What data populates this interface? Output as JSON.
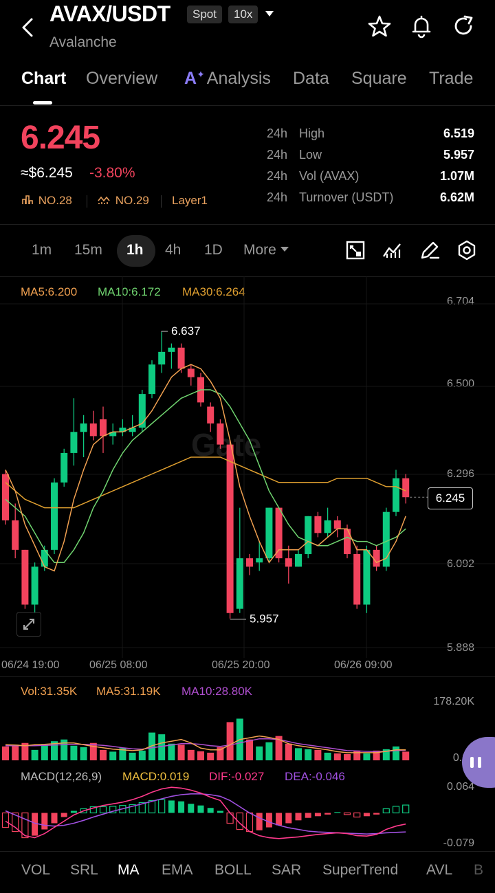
{
  "header": {
    "pair": "AVAX/USDT",
    "spot_tag": "Spot",
    "leverage_tag": "10x",
    "coin_name": "Avalanche"
  },
  "tabs": [
    {
      "label": "Chart"
    },
    {
      "label": "Overview"
    },
    {
      "label": "Analysis",
      "prefix": "A"
    },
    {
      "label": "Data"
    },
    {
      "label": "Square"
    },
    {
      "label": "Trade"
    }
  ],
  "price": {
    "last": "6.245",
    "usd": "≈$6.245",
    "change": "-3.80%",
    "rank1": "NO.28",
    "rank2": "NO.29",
    "category": "Layer1"
  },
  "stats": [
    {
      "period": "24h",
      "label": "High",
      "value": "6.519"
    },
    {
      "period": "24h",
      "label": "Low",
      "value": "5.957"
    },
    {
      "period": "24h",
      "label": "Vol (AVAX)",
      "value": "1.07M"
    },
    {
      "period": "24h",
      "label": "Turnover (USDT)",
      "value": "6.62M"
    }
  ],
  "intervals": [
    {
      "label": "1m"
    },
    {
      "label": "15m"
    },
    {
      "label": "1h"
    },
    {
      "label": "4h"
    },
    {
      "label": "1D"
    },
    {
      "label": "More"
    }
  ],
  "colors": {
    "up": "#0ecb81",
    "down": "#f2435d",
    "ma5": "#f0a050",
    "ma10": "#6fd36f",
    "ma30": "#e0a030",
    "macd_dif": "#ff3a8c",
    "macd_dea": "#a050e0"
  },
  "chart_legend": {
    "ma5": "MA5:6.200",
    "ma10": "MA10:6.172",
    "ma30": "MA30:6.264"
  },
  "watermark": "Gate",
  "price_axis": [
    "6.704",
    "6.500",
    "6.296",
    "6.092",
    "5.888"
  ],
  "time_axis": [
    "06/24 19:00",
    "06/25 08:00",
    "06/25 20:00",
    "06/26 09:00"
  ],
  "annotations": {
    "high": "6.637",
    "low": "5.957"
  },
  "current_price_box": "6.245",
  "volume": {
    "vol": "Vol:31.35K",
    "ma5": "MA5:31.19K",
    "ma10": "MA10:28.80K",
    "axis_top": "178.20K",
    "axis_bottom": "0.00"
  },
  "macd": {
    "params": "MACD(12,26,9)",
    "macd": "MACD:0.019",
    "dif": "DIF:-0.027",
    "dea": "DEA:-0.046",
    "axis_top": "0.064",
    "axis_bottom": "-0.079"
  },
  "indicator_tabs": [
    {
      "label": "VOL"
    },
    {
      "label": "SRL"
    },
    {
      "label": "MA"
    },
    {
      "label": "EMA"
    },
    {
      "label": "BOLL"
    },
    {
      "label": "SAR"
    },
    {
      "label": "SuperTrend"
    },
    {
      "label": "AVL"
    },
    {
      "label": "B"
    }
  ],
  "candles": [
    {
      "o": 6.3,
      "h": 6.31,
      "l": 6.18,
      "c": 6.19
    },
    {
      "o": 6.19,
      "h": 6.23,
      "l": 6.1,
      "c": 6.12
    },
    {
      "o": 6.12,
      "h": 6.12,
      "l": 5.98,
      "c": 5.99
    },
    {
      "o": 5.99,
      "h": 6.09,
      "l": 5.97,
      "c": 6.08
    },
    {
      "o": 6.08,
      "h": 6.13,
      "l": 6.07,
      "c": 6.12
    },
    {
      "o": 6.12,
      "h": 6.29,
      "l": 6.11,
      "c": 6.28
    },
    {
      "o": 6.28,
      "h": 6.36,
      "l": 6.27,
      "c": 6.35
    },
    {
      "o": 6.35,
      "h": 6.48,
      "l": 6.32,
      "c": 6.4
    },
    {
      "o": 6.4,
      "h": 6.44,
      "l": 6.34,
      "c": 6.42
    },
    {
      "o": 6.42,
      "h": 6.45,
      "l": 6.38,
      "c": 6.39
    },
    {
      "o": 6.43,
      "h": 6.46,
      "l": 6.35,
      "c": 6.39
    },
    {
      "o": 6.39,
      "h": 6.42,
      "l": 6.37,
      "c": 6.4
    },
    {
      "o": 6.4,
      "h": 6.43,
      "l": 6.39,
      "c": 6.41
    },
    {
      "o": 6.4,
      "h": 6.44,
      "l": 6.39,
      "c": 6.41
    },
    {
      "o": 6.41,
      "h": 6.5,
      "l": 6.4,
      "c": 6.49
    },
    {
      "o": 6.49,
      "h": 6.57,
      "l": 6.48,
      "c": 6.56
    },
    {
      "o": 6.56,
      "h": 6.637,
      "l": 6.54,
      "c": 6.59
    },
    {
      "o": 6.59,
      "h": 6.61,
      "l": 6.55,
      "c": 6.6
    },
    {
      "o": 6.6,
      "h": 6.61,
      "l": 6.54,
      "c": 6.55
    },
    {
      "o": 6.55,
      "h": 6.56,
      "l": 6.51,
      "c": 6.53
    },
    {
      "o": 6.53,
      "h": 6.54,
      "l": 6.46,
      "c": 6.47
    },
    {
      "o": 6.46,
      "h": 6.47,
      "l": 6.4,
      "c": 6.42
    },
    {
      "o": 6.42,
      "h": 6.43,
      "l": 6.36,
      "c": 6.37
    },
    {
      "o": 6.37,
      "h": 6.38,
      "l": 5.957,
      "c": 5.97
    },
    {
      "o": 5.98,
      "h": 6.22,
      "l": 5.97,
      "c": 6.1
    },
    {
      "o": 6.1,
      "h": 6.11,
      "l": 6.06,
      "c": 6.08
    },
    {
      "o": 6.09,
      "h": 6.14,
      "l": 6.07,
      "c": 6.1
    },
    {
      "o": 6.1,
      "h": 6.22,
      "l": 6.09,
      "c": 6.22
    },
    {
      "o": 6.22,
      "h": 6.22,
      "l": 6.09,
      "c": 6.1
    },
    {
      "o": 6.1,
      "h": 6.13,
      "l": 6.04,
      "c": 6.08
    },
    {
      "o": 6.08,
      "h": 6.12,
      "l": 6.08,
      "c": 6.11
    },
    {
      "o": 6.11,
      "h": 6.2,
      "l": 6.1,
      "c": 6.2
    },
    {
      "o": 6.2,
      "h": 6.21,
      "l": 6.15,
      "c": 6.16
    },
    {
      "o": 6.16,
      "h": 6.22,
      "l": 6.15,
      "c": 6.19
    },
    {
      "o": 6.19,
      "h": 6.2,
      "l": 6.15,
      "c": 6.17
    },
    {
      "o": 6.17,
      "h": 6.18,
      "l": 6.1,
      "c": 6.11
    },
    {
      "o": 6.11,
      "h": 6.13,
      "l": 5.98,
      "c": 5.99
    },
    {
      "o": 5.99,
      "h": 6.13,
      "l": 5.97,
      "c": 6.12
    },
    {
      "o": 6.12,
      "h": 6.13,
      "l": 6.07,
      "c": 6.08
    },
    {
      "o": 6.08,
      "h": 6.22,
      "l": 6.07,
      "c": 6.21
    },
    {
      "o": 6.21,
      "h": 6.31,
      "l": 6.2,
      "c": 6.29
    },
    {
      "o": 6.29,
      "h": 6.3,
      "l": 6.23,
      "c": 6.245
    }
  ],
  "ma5": [
    6.31,
    6.26,
    6.18,
    6.13,
    6.08,
    6.07,
    6.14,
    6.24,
    6.31,
    6.37,
    6.39,
    6.4,
    6.4,
    6.41,
    6.42,
    6.45,
    6.49,
    6.53,
    6.55,
    6.56,
    6.55,
    6.52,
    6.48,
    6.38,
    6.27,
    6.2,
    6.14,
    6.09,
    6.12,
    6.12,
    6.12,
    6.14,
    6.13,
    6.15,
    6.17,
    6.17,
    6.12,
    6.12,
    6.09,
    6.1,
    6.14,
    6.2
  ],
  "ma10": [
    6.24,
    6.22,
    6.2,
    6.16,
    6.12,
    6.09,
    6.09,
    6.12,
    6.16,
    6.22,
    6.26,
    6.31,
    6.35,
    6.38,
    6.4,
    6.42,
    6.44,
    6.46,
    6.48,
    6.49,
    6.5,
    6.5,
    6.49,
    6.46,
    6.42,
    6.38,
    6.32,
    6.26,
    6.22,
    6.18,
    6.15,
    6.14,
    6.13,
    6.13,
    6.14,
    6.15,
    6.14,
    6.14,
    6.13,
    6.14,
    6.15,
    6.17
  ],
  "ma30": [
    6.28,
    6.26,
    6.24,
    6.23,
    6.22,
    6.22,
    6.22,
    6.22,
    6.23,
    6.24,
    6.25,
    6.26,
    6.27,
    6.28,
    6.29,
    6.3,
    6.31,
    6.32,
    6.33,
    6.34,
    6.34,
    6.34,
    6.34,
    6.33,
    6.32,
    6.31,
    6.3,
    6.29,
    6.28,
    6.28,
    6.28,
    6.28,
    6.28,
    6.28,
    6.29,
    6.29,
    6.29,
    6.29,
    6.28,
    6.27,
    6.27,
    6.26
  ],
  "vol_values": [
    40,
    45,
    50,
    30,
    45,
    55,
    60,
    42,
    38,
    50,
    30,
    25,
    35,
    22,
    28,
    80,
    75,
    48,
    45,
    30,
    26,
    22,
    38,
    110,
    120,
    60,
    40,
    52,
    70,
    48,
    35,
    32,
    30,
    22,
    20,
    18,
    28,
    20,
    28,
    32,
    40,
    25
  ],
  "vol_ma5": [
    45,
    44,
    42,
    45,
    46,
    48,
    50,
    50,
    45,
    40,
    36,
    32,
    30,
    28,
    30,
    42,
    50,
    55,
    60,
    50,
    35,
    30,
    30,
    45,
    60,
    65,
    70,
    66,
    60,
    48,
    42,
    38,
    34,
    30,
    25,
    22,
    22,
    22,
    22,
    26,
    30,
    30
  ],
  "vol_ma10": [
    42,
    42,
    42,
    42,
    43,
    44,
    45,
    46,
    46,
    45,
    43,
    40,
    36,
    33,
    32,
    36,
    40,
    44,
    48,
    48,
    46,
    42,
    40,
    44,
    50,
    56,
    62,
    62,
    60,
    54,
    48,
    44,
    40,
    36,
    32,
    28,
    27,
    26,
    25,
    26,
    28,
    29
  ],
  "macd_hist": [
    -0.035,
    -0.045,
    -0.06,
    -0.055,
    -0.04,
    -0.025,
    -0.01,
    0.005,
    0.01,
    0.015,
    0.015,
    0.016,
    0.018,
    0.02,
    0.025,
    0.03,
    0.032,
    0.03,
    0.028,
    0.022,
    0.018,
    0.012,
    0.005,
    -0.025,
    -0.04,
    -0.045,
    -0.042,
    -0.035,
    -0.03,
    -0.025,
    -0.018,
    -0.012,
    -0.008,
    -0.004,
    0.002,
    -0.004,
    -0.01,
    -0.008,
    -0.004,
    0.01,
    0.016,
    0.019
  ],
  "macd_dif": [
    -0.02,
    -0.035,
    -0.055,
    -0.06,
    -0.05,
    -0.035,
    -0.02,
    -0.005,
    0.005,
    0.012,
    0.018,
    0.022,
    0.026,
    0.032,
    0.04,
    0.05,
    0.058,
    0.062,
    0.06,
    0.055,
    0.048,
    0.038,
    0.03,
    0.0,
    -0.025,
    -0.045,
    -0.055,
    -0.06,
    -0.062,
    -0.06,
    -0.058,
    -0.055,
    -0.052,
    -0.05,
    -0.048,
    -0.05,
    -0.055,
    -0.056,
    -0.052,
    -0.04,
    -0.032,
    -0.027
  ],
  "macd_dea": [
    0.005,
    -0.005,
    -0.015,
    -0.025,
    -0.03,
    -0.032,
    -0.03,
    -0.025,
    -0.018,
    -0.01,
    -0.003,
    0.004,
    0.01,
    0.016,
    0.022,
    0.028,
    0.034,
    0.04,
    0.044,
    0.046,
    0.046,
    0.044,
    0.04,
    0.03,
    0.015,
    0.0,
    -0.012,
    -0.022,
    -0.03,
    -0.036,
    -0.04,
    -0.044,
    -0.046,
    -0.047,
    -0.048,
    -0.049,
    -0.05,
    -0.051,
    -0.05,
    -0.048,
    -0.047,
    -0.046
  ]
}
